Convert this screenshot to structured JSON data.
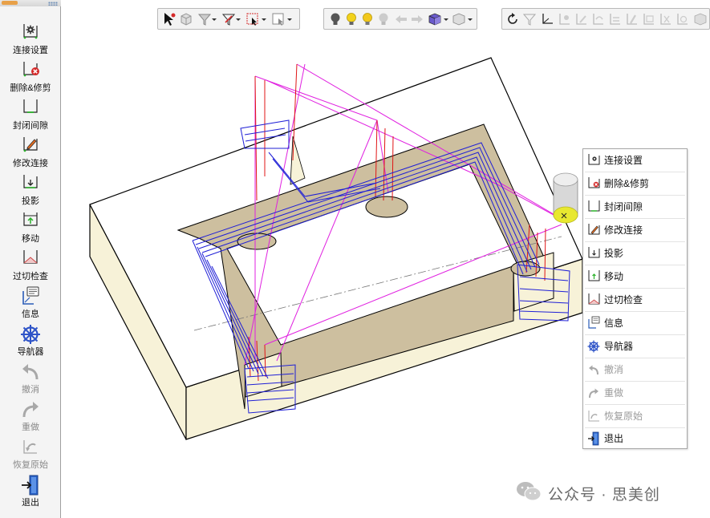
{
  "left_toolbar": {
    "items": [
      {
        "label": "连接设置",
        "icon": "gear-icon",
        "enabled": true
      },
      {
        "label": "删除&修剪",
        "icon": "delete-icon",
        "enabled": true
      },
      {
        "label": "封闭间隙",
        "icon": "close-gap-icon",
        "enabled": true
      },
      {
        "label": "修改连接",
        "icon": "pencil-icon",
        "enabled": true
      },
      {
        "label": "投影",
        "icon": "project-icon",
        "enabled": true
      },
      {
        "label": "移动",
        "icon": "move-icon",
        "enabled": true
      },
      {
        "label": "过切检查",
        "icon": "gouge-check-icon",
        "enabled": true
      },
      {
        "label": "信息",
        "icon": "info-icon",
        "enabled": true
      },
      {
        "label": "导航器",
        "icon": "navigator-wheel-icon",
        "enabled": true
      },
      {
        "label": "撤消",
        "icon": "undo-icon",
        "enabled": false
      },
      {
        "label": "重做",
        "icon": "redo-icon",
        "enabled": false
      },
      {
        "label": "恢复原始",
        "icon": "restore-icon",
        "enabled": false
      },
      {
        "label": "退出",
        "icon": "exit-icon",
        "enabled": true
      }
    ]
  },
  "context_menu": {
    "items": [
      {
        "label": "连接设置",
        "icon": "gear-icon",
        "enabled": true
      },
      {
        "label": "删除&修剪",
        "icon": "delete-icon",
        "enabled": true
      },
      {
        "label": "封闭间隙",
        "icon": "close-gap-icon",
        "enabled": true
      },
      {
        "label": "修改连接",
        "icon": "pencil-icon",
        "enabled": true
      },
      {
        "label": "投影",
        "icon": "project-icon",
        "enabled": true
      },
      {
        "label": "移动",
        "icon": "move-icon",
        "enabled": true
      },
      {
        "label": "过切检查",
        "icon": "gouge-check-icon",
        "enabled": true
      },
      {
        "label": "信息",
        "icon": "info-icon",
        "enabled": true
      },
      {
        "label": "导航器",
        "icon": "navigator-wheel-icon",
        "enabled": true
      },
      {
        "label": "撤消",
        "icon": "undo-icon",
        "enabled": false
      },
      {
        "label": "重做",
        "icon": "redo-icon",
        "enabled": false
      },
      {
        "label": "恢复原始",
        "icon": "restore-icon",
        "enabled": false
      },
      {
        "label": "退出",
        "icon": "exit-icon",
        "enabled": true
      }
    ]
  },
  "top_toolbars": {
    "selection": [
      "select-arrow-icon",
      "box-select-icon",
      "filter-icon",
      "window-select-icon",
      "lasso-icon"
    ],
    "view": [
      "light-off-icon",
      "light-on-icon",
      "light-yellow-icon",
      "light-dim-icon",
      "arrow-left-icon",
      "arrow-right-icon",
      "cube-view-icon",
      "shaded-icon"
    ],
    "tool_editing": [
      "rotate-icon",
      "drill-icon",
      "axis-icon",
      "toolpath-a-icon",
      "toolpath-b-icon",
      "toolpath-c-icon",
      "toolpath-d-icon",
      "toolpath-e-icon",
      "toolpath-f-icon",
      "toolpath-g-icon",
      "toolpath-h-icon",
      "solid-icon"
    ]
  },
  "colors": {
    "part_top": "#ffffff",
    "part_side": "#f7f2d8",
    "pocket_wall": "#cdbf9f",
    "toolpath_cut": "#1f1fd6",
    "toolpath_plunge": "#e01515",
    "toolpath_link": "#e020e0",
    "tool_cylinder": "#d8d8d8",
    "tool_tip": "#e8e830"
  },
  "watermark": {
    "text": "公众号 · 思美创",
    "icon": "wechat-icon"
  }
}
